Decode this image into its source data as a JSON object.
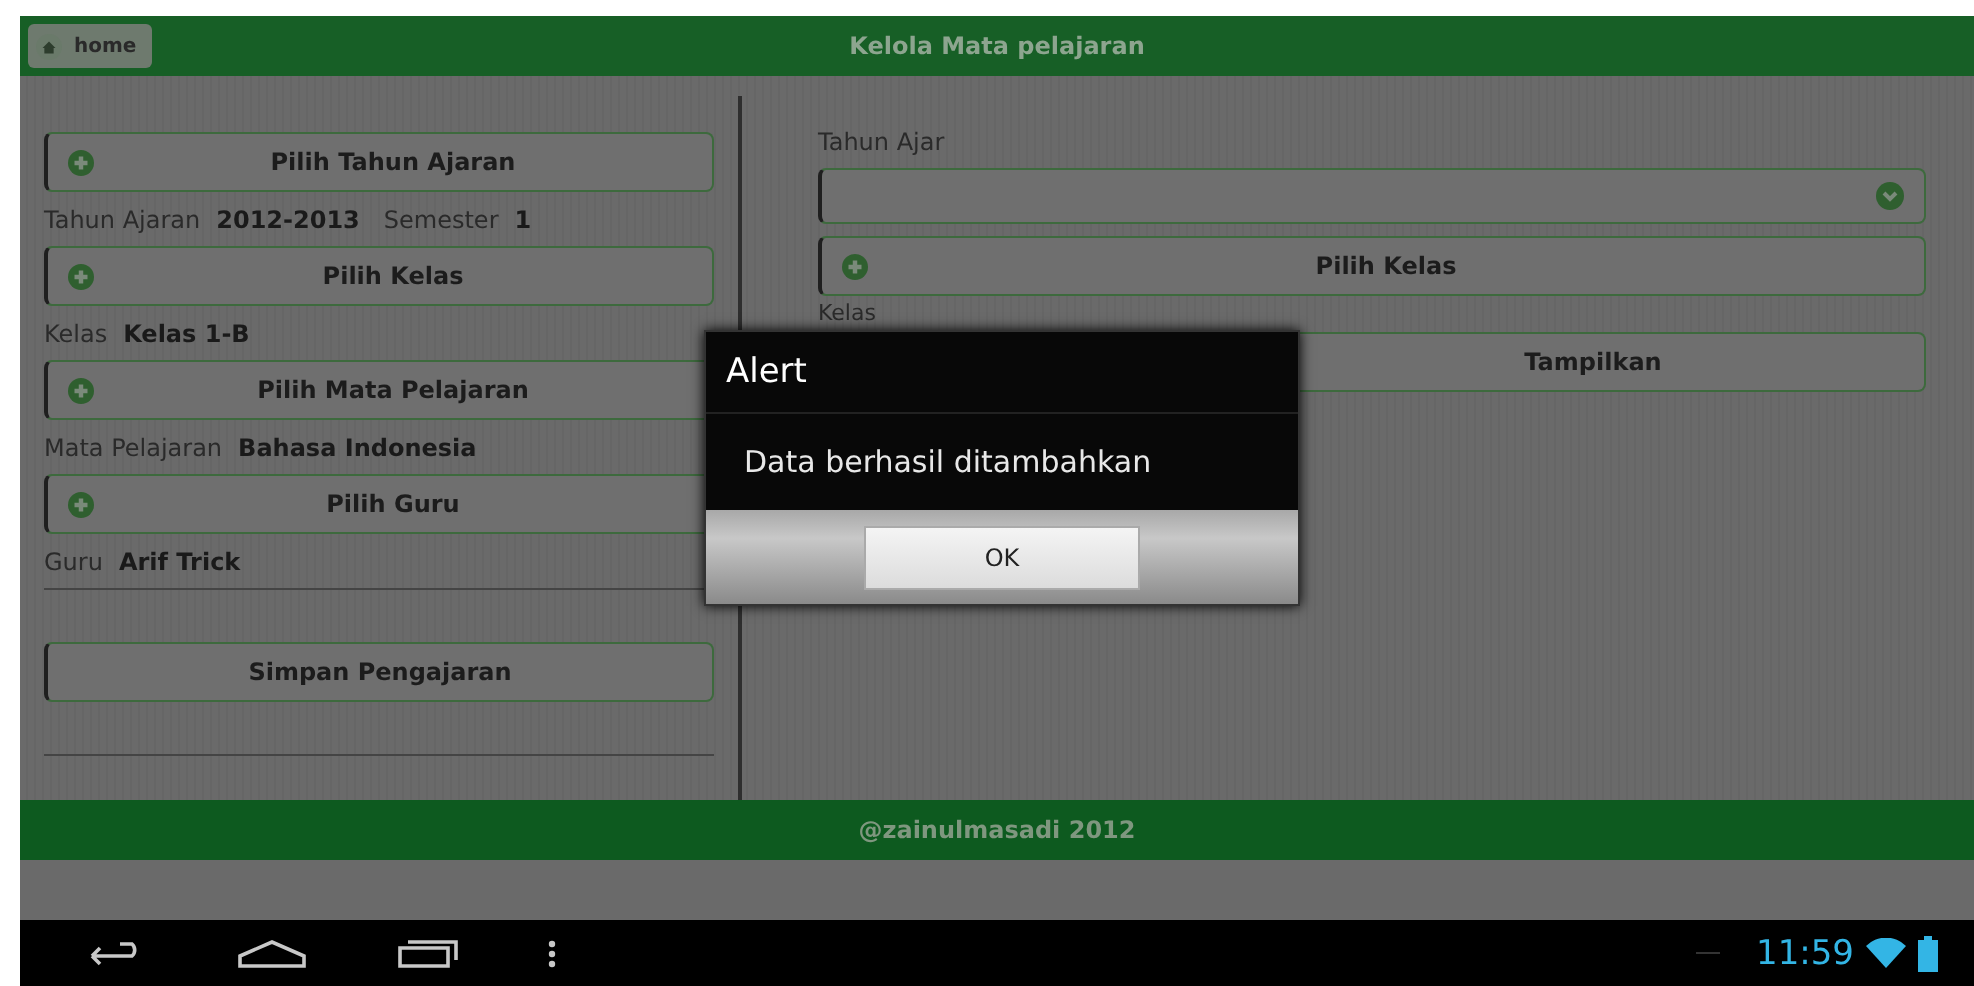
{
  "header": {
    "home_button": "home",
    "title": "Kelola Mata pelajaran"
  },
  "left_panel": {
    "sections": [
      {
        "button": "Pilih Tahun Ajaran",
        "info": [
          {
            "label": "Tahun Ajaran",
            "value": "2012-2013"
          },
          {
            "label": "Semester",
            "value": "1"
          }
        ]
      },
      {
        "button": "Pilih Kelas",
        "info": [
          {
            "label": "Kelas",
            "value": "Kelas 1-B"
          }
        ]
      },
      {
        "button": "Pilih Mata Pelajaran",
        "info": [
          {
            "label": "Mata Pelajaran",
            "value": "Bahasa Indonesia"
          }
        ]
      },
      {
        "button": "Pilih Guru",
        "info": [
          {
            "label": "Guru",
            "value": "Arif Trick"
          }
        ]
      }
    ],
    "save_button": "Simpan Pengajaran"
  },
  "right_panel": {
    "year_label": "Tahun Ajar",
    "class_button": "Pilih Kelas",
    "class_label": "Kelas",
    "show_button": "Tampilkan"
  },
  "dialog": {
    "title": "Alert",
    "message": "Data berhasil ditambahkan",
    "button": "OK"
  },
  "footer": "@zainulmasadi 2012",
  "nav_bar": {
    "time": "11:59"
  }
}
